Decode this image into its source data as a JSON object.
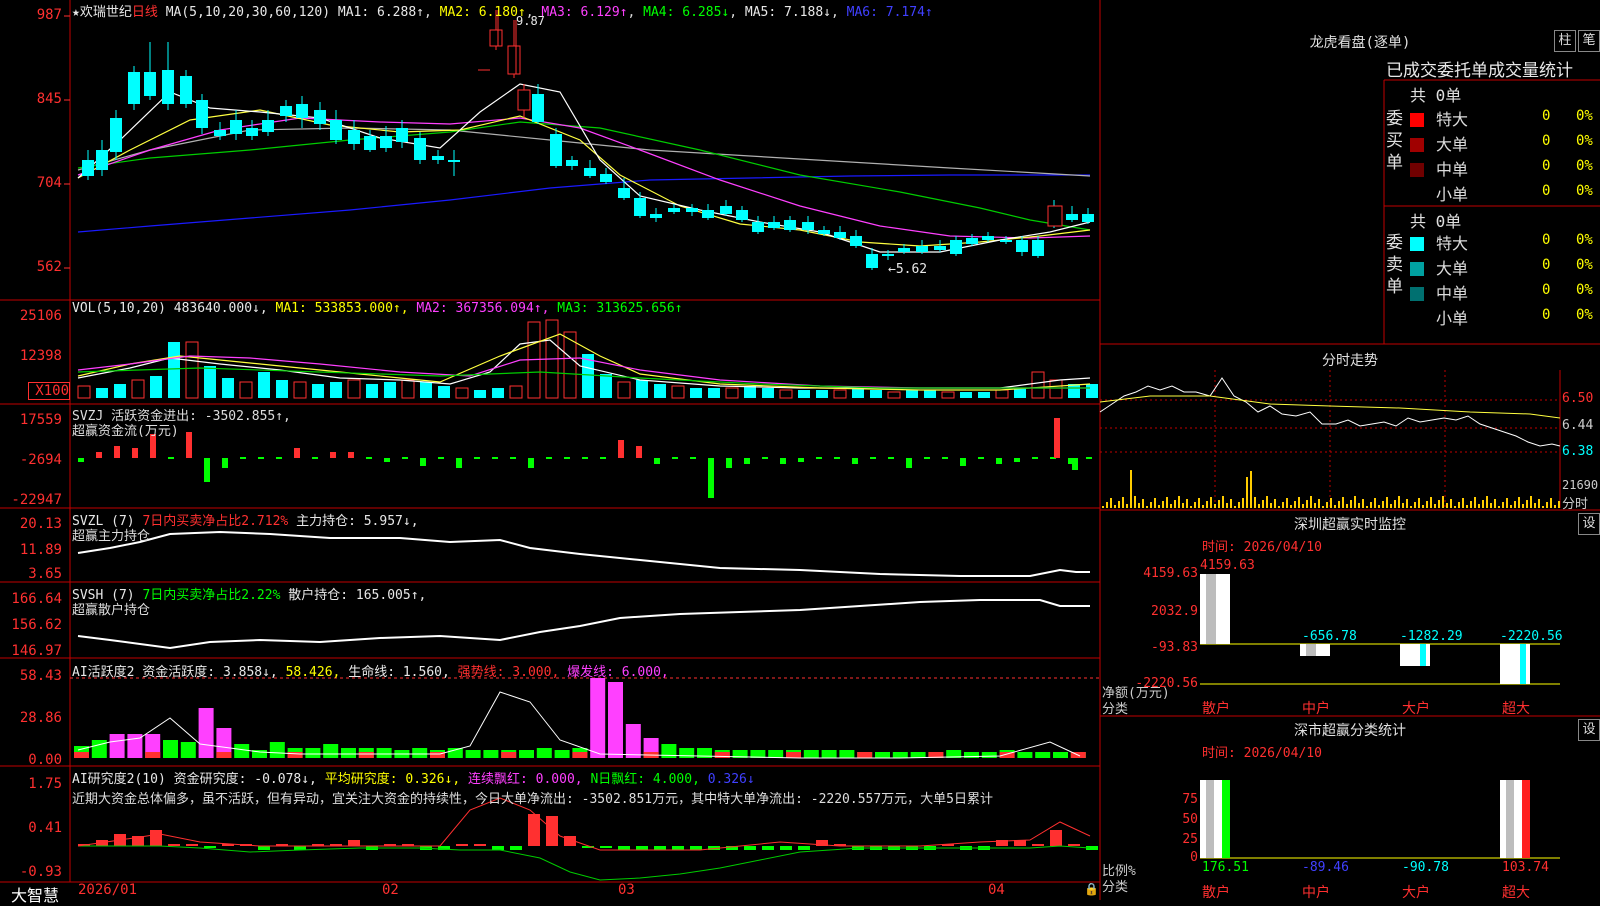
{
  "stock_name": "欢瑞世纪",
  "period": "日线",
  "price_axis": [
    "987",
    "845",
    "704",
    "562"
  ],
  "ma_header": {
    "label": "MA(5,10,20,30,60,120)",
    "ma1": "MA1: 6.288↑",
    "ma2": "MA2: 6.180↑",
    "ma3": "MA3: 6.129↑",
    "ma4": "MA4: 6.285↓",
    "ma5": "MA5: 7.188↓",
    "ma6": "MA6: 7.174↑"
  },
  "peak_label": "9.87",
  "low_label": "5.62",
  "vol": {
    "axis": [
      "25106",
      "12398",
      "X100"
    ],
    "label": "VOL(5,10,20)",
    "value": "483640.000↓,",
    "ma1": "MA1: 533853.000↑,",
    "ma2": "MA2: 367356.094↑,",
    "ma3": "MA3: 313625.656↑"
  },
  "svzj": {
    "axis": [
      "17559",
      "-2694",
      "-22947"
    ],
    "label": "SVZJ  活跃资金进出: -3502.855↑,",
    "sub": "超赢资金流(万元)"
  },
  "svzl": {
    "axis": [
      "20.13",
      "11.89",
      "3.65"
    ],
    "label": "SVZL (7)",
    "ratio": "7日内买卖净占比2.712%",
    "hold": "主力持仓: 5.957↓,",
    "sub": "超赢主力持仓"
  },
  "svsh": {
    "axis": [
      "166.64",
      "156.62",
      "146.97"
    ],
    "label": "SVSH (7)",
    "ratio": "7日内买卖净占比2.22%",
    "hold": "散户持仓: 165.005↑,",
    "sub": "超赢散户持仓"
  },
  "ai_active": {
    "axis": [
      "58.43",
      "28.86",
      "0.00"
    ],
    "label": "AI活跃度2 资金活跃度: 3.858↓,",
    "v2": "58.426,",
    "life": "生命线: 1.560,",
    "strong": "强势线: 3.000,",
    "burst": "爆发线: 6.000,"
  },
  "ai_research": {
    "axis": [
      "1.75",
      "0.41",
      "-0.93"
    ],
    "label": "AI研究度2(10) 资金研究度: -0.078↓,",
    "avg": "平均研究度: 0.326↓,",
    "cont": "连续飘红: 0.000,",
    "nday": "N日飘红: 4.000,",
    "v": "0.326↓",
    "comment": "近期大资金总体偏多，虽不活跃，但有异动，宜关注大资金的持续性，今日大单净流出: -3502.851万元，其中特大单净流出: -2220.557万元，大单5日累计"
  },
  "date_axis": [
    "2026/01",
    "02",
    "03",
    "04"
  ],
  "brand": "大智慧",
  "lhb": {
    "title": "龙虎看盘(逐单)",
    "btn1": "柱",
    "btn2": "笔",
    "subtitle": "已成交委托单成交量统计",
    "buy_side": "委买单",
    "sell_side": "委卖单",
    "buy_total": "共 0单",
    "sell_total": "共 0单",
    "rows": [
      "特大",
      "大单",
      "中单",
      "小单"
    ],
    "zero": "0",
    "pct": "0%"
  },
  "intraday": {
    "title": "分时走势",
    "axis": [
      "6.50",
      "6.44",
      "6.38",
      "21690",
      "分时"
    ]
  },
  "sz_monitor": {
    "title": "深圳超赢实时监控",
    "set": "设",
    "time": "时间: 2026/04/10",
    "axis": [
      "4159.63",
      "2032.9",
      "-93.83",
      "-2220.56"
    ],
    "values": [
      "4159.63",
      "-656.78",
      "-1282.29",
      "-2220.56"
    ],
    "ylabel": "净额(万元)",
    "xlabel": "分类",
    "cats": [
      "散户",
      "中户",
      "大户",
      "超大"
    ]
  },
  "sz_class": {
    "title": "深市超赢分类统计",
    "set": "设",
    "time": "时间: 2026/04/10",
    "axis": [
      "75",
      "50",
      "25",
      "0"
    ],
    "values": [
      "176.51",
      "-89.46",
      "-90.78",
      "103.74"
    ],
    "ylabel": "比例%",
    "xlabel": "分类",
    "cats": [
      "散户",
      "中户",
      "大户",
      "超大"
    ]
  },
  "colors": {
    "up": "#ff3030",
    "down": "#00ffff",
    "grid": "#c00000"
  }
}
